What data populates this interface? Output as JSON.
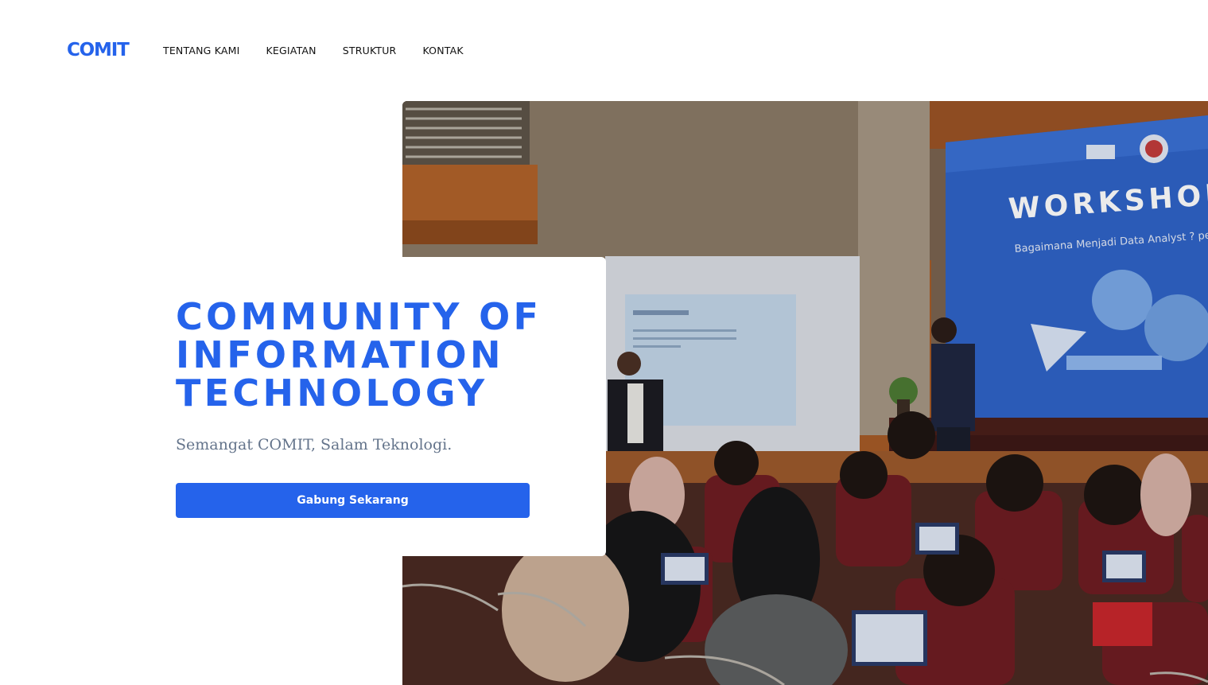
{
  "header": {
    "logo": "COMIT",
    "nav": [
      {
        "label": "TENTANG KAMI"
      },
      {
        "label": "KEGIATAN"
      },
      {
        "label": "STRUKTUR"
      },
      {
        "label": "KONTAK"
      }
    ]
  },
  "hero": {
    "title_lines": [
      "COMMUNITY OF",
      "INFORMATION",
      "TECHNOLOGY"
    ],
    "subtitle": "Semangat COMIT, Salam Teknologi.",
    "cta_label": "Gabung Sekarang",
    "photo": {
      "banner_heading": "WORKSHOP DA",
      "banner_subheading": "Bagaimana Menjadi Data Analyst ? pe"
    }
  },
  "colors": {
    "brand": "#2563eb",
    "subtitle": "#64748b",
    "nav_text": "#111111"
  }
}
